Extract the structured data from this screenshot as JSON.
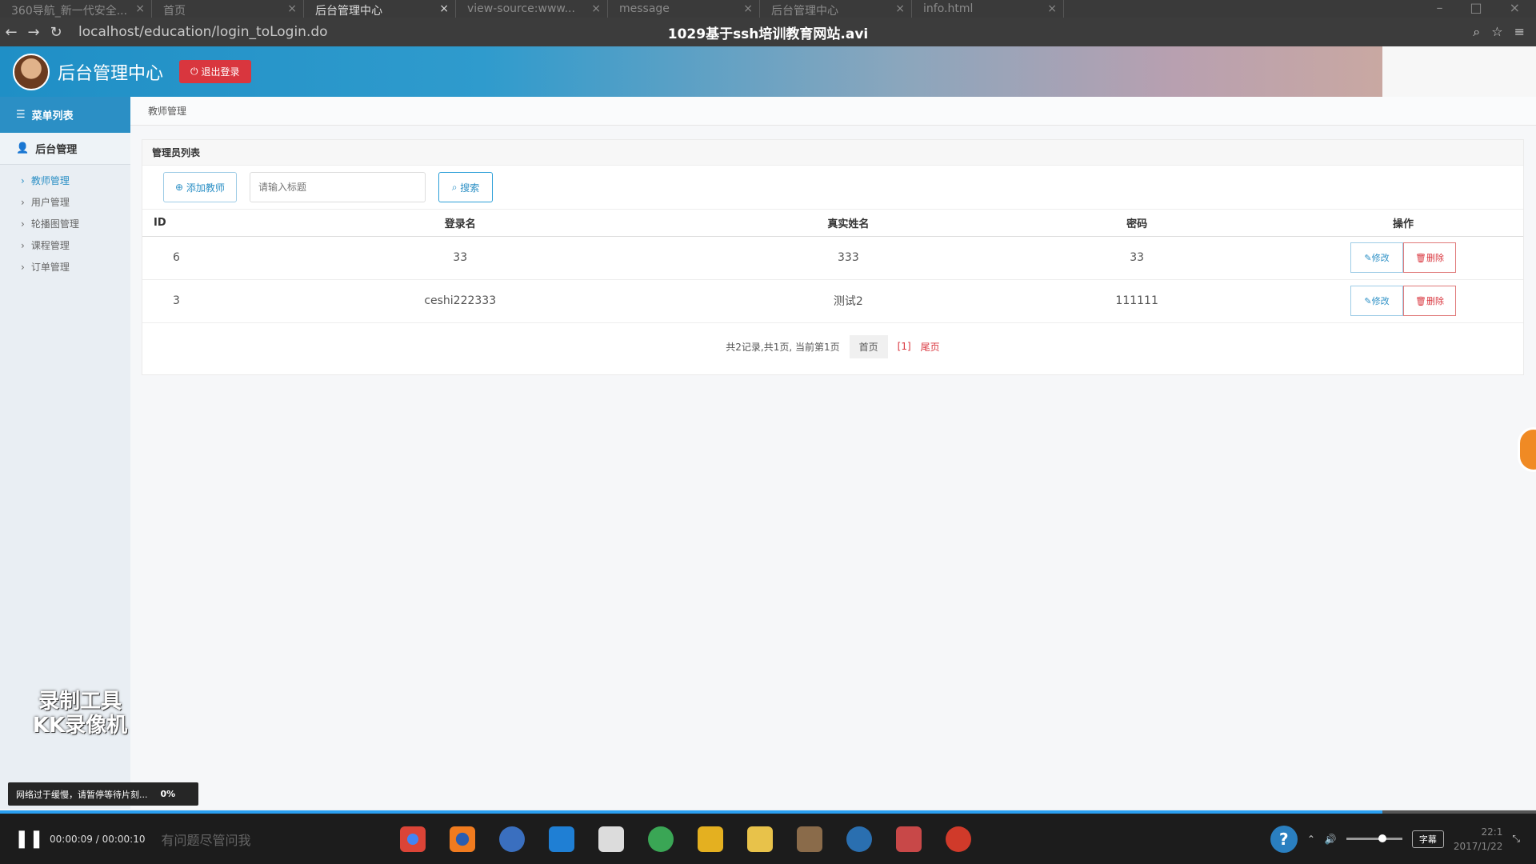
{
  "browser": {
    "tabs": [
      {
        "label": "360导航_新一代安全..."
      },
      {
        "label": "首页"
      },
      {
        "label": "后台管理中心"
      },
      {
        "label": "view-source:www..."
      },
      {
        "label": "message"
      },
      {
        "label": "后台管理中心"
      },
      {
        "label": "info.html"
      }
    ],
    "url": "localhost/education/login_toLogin.do",
    "video_title": "1029基于ssh培训教育网站.avi"
  },
  "header": {
    "title": "后台管理中心",
    "logout_label": "退出登录"
  },
  "sidebar": {
    "menu_title": "菜单列表",
    "group_label": "后台管理",
    "items": [
      {
        "label": "教师管理"
      },
      {
        "label": "用户管理"
      },
      {
        "label": "轮播图管理"
      },
      {
        "label": "课程管理"
      },
      {
        "label": "订单管理"
      }
    ],
    "watermark_line1": "录制工具",
    "watermark_line2": "KK录像机"
  },
  "main": {
    "breadcrumb": "教师管理",
    "panel_title": "管理员列表",
    "add_button": "添加教师",
    "search_placeholder": "请输入标题",
    "search_button": "搜索",
    "columns": [
      "ID",
      "登录名",
      "真实姓名",
      "密码",
      "操作"
    ],
    "rows": [
      {
        "id": "6",
        "login": "33",
        "name": "333",
        "password": "33"
      },
      {
        "id": "3",
        "login": "ceshi222333",
        "name": "测试2",
        "password": "111111"
      }
    ],
    "edit_label": "修改",
    "delete_label": "删除",
    "pagination": {
      "summary": "共2记录,共1页, 当前第1页",
      "first": "首页",
      "current": "[1]",
      "last": "尾页"
    }
  },
  "player": {
    "toast": "网络过于缓慢，请暂停等待片刻...",
    "toast_percent": "0%",
    "time": "00:00:09 / 00:00:10",
    "progress": 0.9,
    "subtitle_label": "字幕",
    "clock_time": "22:1",
    "clock_date": "2017/1/22",
    "search_hint": "有问题尽管问我"
  },
  "colors": {
    "accent": "#2b8fc5",
    "danger": "#d9363e"
  }
}
